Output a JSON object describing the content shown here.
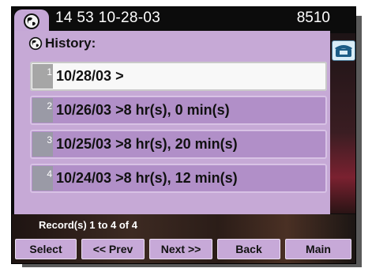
{
  "status": {
    "time": "14 53 10-28-03",
    "extension": "8510"
  },
  "panel": {
    "title": "History:",
    "rows": [
      {
        "number": "1",
        "text": "10/28/03 >",
        "selected": true
      },
      {
        "number": "2",
        "text": "10/26/03 >8 hr(s), 0 min(s)",
        "selected": false
      },
      {
        "number": "3",
        "text": "10/25/03 >8 hr(s), 20 min(s)",
        "selected": false
      },
      {
        "number": "4",
        "text": "10/24/03 >8 hr(s), 12 min(s)",
        "selected": false
      }
    ]
  },
  "records": "Record(s) 1 to 4 of 4",
  "softkeys": [
    "Select",
    "<< Prev",
    "Next >>",
    "Back",
    "Main"
  ],
  "icons": {
    "tab": "globe-icon",
    "title": "globe-icon",
    "line": "phone-icon"
  },
  "colors": {
    "panel": "#c6a9d6",
    "row": "#b18fc8",
    "selected_row": "#f8f8f8",
    "softkey": "#c7a9d8"
  }
}
